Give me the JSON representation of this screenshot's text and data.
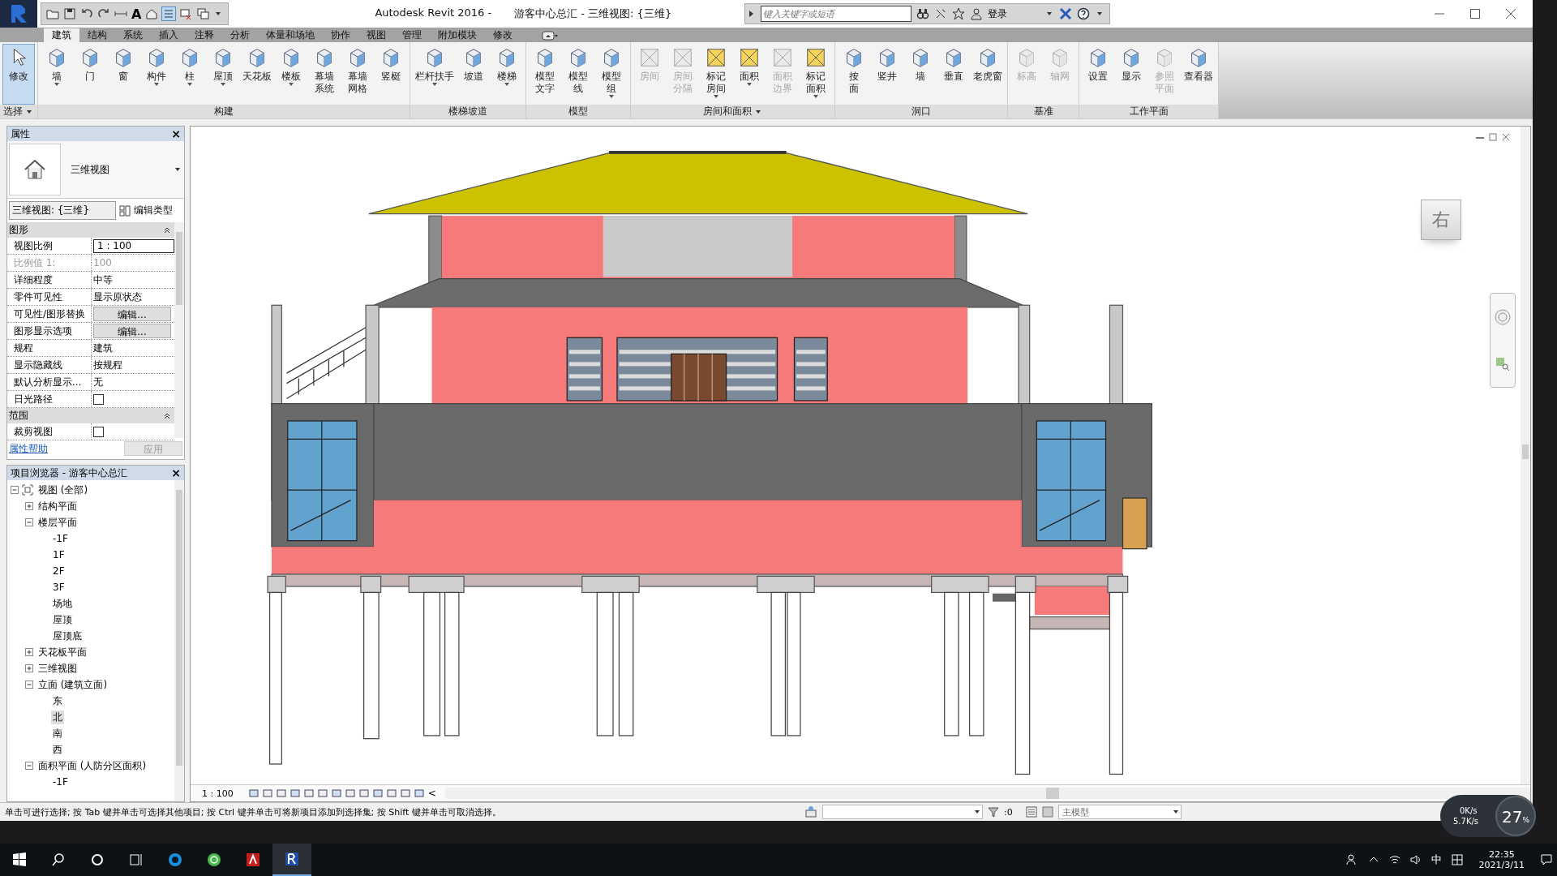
{
  "app": {
    "title": "Autodesk Revit 2016 -",
    "document": "游客中心总汇 - 三维视图: {三维}",
    "qat_text": "A",
    "search": {
      "placeholder": "键入关键字或短语"
    },
    "login": "登录"
  },
  "ribbon": {
    "tabs": [
      {
        "label": "建筑",
        "selected": true
      },
      {
        "label": "结构",
        "selected": false
      },
      {
        "label": "系统",
        "selected": false
      },
      {
        "label": "插入",
        "selected": false
      },
      {
        "label": "注释",
        "selected": false
      },
      {
        "label": "分析",
        "selected": false
      },
      {
        "label": "体量和场地",
        "selected": false
      },
      {
        "label": "协作",
        "selected": false
      },
      {
        "label": "视图",
        "selected": false
      },
      {
        "label": "管理",
        "selected": false
      },
      {
        "label": "附加模块",
        "selected": false
      },
      {
        "label": "修改",
        "selected": false
      }
    ],
    "panels": [
      {
        "label": "选择",
        "menu": true,
        "tools": [
          {
            "label": [
              "修改"
            ],
            "selected": true,
            "disabled": false,
            "dropdown": false
          }
        ]
      },
      {
        "label": "构建",
        "menu": false,
        "tools": [
          {
            "label": [
              "墙"
            ],
            "selected": false,
            "disabled": false,
            "dropdown": true
          },
          {
            "label": [
              "门"
            ],
            "selected": false,
            "disabled": false,
            "dropdown": false
          },
          {
            "label": [
              "窗"
            ],
            "selected": false,
            "disabled": false,
            "dropdown": false
          },
          {
            "label": [
              "构件"
            ],
            "selected": false,
            "disabled": false,
            "dropdown": true
          },
          {
            "label": [
              "柱"
            ],
            "selected": false,
            "disabled": false,
            "dropdown": true
          },
          {
            "label": [
              "屋顶"
            ],
            "selected": false,
            "disabled": false,
            "dropdown": true
          },
          {
            "label": [
              "天花板"
            ],
            "selected": false,
            "disabled": false,
            "dropdown": false
          },
          {
            "label": [
              "楼板"
            ],
            "selected": false,
            "disabled": false,
            "dropdown": true
          },
          {
            "label": [
              "幕墙",
              "系统"
            ],
            "selected": false,
            "disabled": false,
            "dropdown": false
          },
          {
            "label": [
              "幕墙",
              "网格"
            ],
            "selected": false,
            "disabled": false,
            "dropdown": false
          },
          {
            "label": [
              "竖梃"
            ],
            "selected": false,
            "disabled": false,
            "dropdown": false
          }
        ]
      },
      {
        "label": "楼梯坡道",
        "menu": false,
        "tools": [
          {
            "label": [
              "栏杆扶手"
            ],
            "selected": false,
            "disabled": false,
            "dropdown": true
          },
          {
            "label": [
              "坡道"
            ],
            "selected": false,
            "disabled": false,
            "dropdown": false
          },
          {
            "label": [
              "楼梯"
            ],
            "selected": false,
            "disabled": false,
            "dropdown": true
          }
        ]
      },
      {
        "label": "模型",
        "menu": false,
        "tools": [
          {
            "label": [
              "模型",
              "文字"
            ],
            "selected": false,
            "disabled": false,
            "dropdown": false
          },
          {
            "label": [
              "模型",
              "线"
            ],
            "selected": false,
            "disabled": false,
            "dropdown": false
          },
          {
            "label": [
              "模型",
              "组"
            ],
            "selected": false,
            "disabled": false,
            "dropdown": true
          }
        ]
      },
      {
        "label": "房间和面积",
        "menu": true,
        "tools": [
          {
            "label": [
              "房间"
            ],
            "selected": false,
            "disabled": true,
            "dropdown": false
          },
          {
            "label": [
              "房间",
              "分隔"
            ],
            "selected": false,
            "disabled": true,
            "dropdown": false
          },
          {
            "label": [
              "标记",
              "房间"
            ],
            "selected": false,
            "disabled": false,
            "dropdown": true
          },
          {
            "label": [
              "面积"
            ],
            "selected": false,
            "disabled": false,
            "dropdown": true
          },
          {
            "label": [
              "面积",
              "边界"
            ],
            "selected": false,
            "disabled": true,
            "dropdown": false
          },
          {
            "label": [
              "标记",
              "面积"
            ],
            "selected": false,
            "disabled": false,
            "dropdown": true
          }
        ]
      },
      {
        "label": "洞口",
        "menu": false,
        "tools": [
          {
            "label": [
              "按",
              "面"
            ],
            "selected": false,
            "disabled": false,
            "dropdown": false
          },
          {
            "label": [
              "竖井"
            ],
            "selected": false,
            "disabled": false,
            "dropdown": false
          },
          {
            "label": [
              "墙"
            ],
            "selected": false,
            "disabled": false,
            "dropdown": false
          },
          {
            "label": [
              "垂直"
            ],
            "selected": false,
            "disabled": false,
            "dropdown": false
          },
          {
            "label": [
              "老虎窗"
            ],
            "selected": false,
            "disabled": false,
            "dropdown": false
          }
        ]
      },
      {
        "label": "基准",
        "menu": false,
        "tools": [
          {
            "label": [
              "标高"
            ],
            "selected": false,
            "disabled": true,
            "dropdown": false
          },
          {
            "label": [
              "轴网"
            ],
            "selected": false,
            "disabled": true,
            "dropdown": false
          }
        ]
      },
      {
        "label": "工作平面",
        "menu": false,
        "tools": [
          {
            "label": [
              "设置"
            ],
            "selected": false,
            "disabled": false,
            "dropdown": false
          },
          {
            "label": [
              "显示"
            ],
            "selected": false,
            "disabled": false,
            "dropdown": false
          },
          {
            "label": [
              "参照",
              "平面"
            ],
            "selected": false,
            "disabled": true,
            "dropdown": false
          },
          {
            "label": [
              "查看器"
            ],
            "selected": false,
            "disabled": false,
            "dropdown": false
          }
        ]
      }
    ]
  },
  "properties": {
    "title": "属性",
    "close": "×",
    "type_name": "三维视图",
    "instance": "三维视图: {三维}",
    "edit_type": "编辑类型",
    "groups": [
      {
        "label": "图形",
        "expanded": true,
        "rows": [
          {
            "label": "视图比例",
            "kind": "input",
            "value": "1 : 100",
            "disabled": false
          },
          {
            "label": "比例值 1:",
            "kind": "text",
            "value": "100",
            "disabled": true
          },
          {
            "label": "详细程度",
            "kind": "text",
            "value": "中等",
            "disabled": false
          },
          {
            "label": "零件可见性",
            "kind": "text",
            "value": "显示原状态",
            "disabled": false
          },
          {
            "label": "可见性/图形替换",
            "kind": "button",
            "value": "编辑...",
            "disabled": false
          },
          {
            "label": "图形显示选项",
            "kind": "button",
            "value": "编辑...",
            "disabled": false
          },
          {
            "label": "规程",
            "kind": "text",
            "value": "建筑",
            "disabled": false
          },
          {
            "label": "显示隐藏线",
            "kind": "text",
            "value": "按规程",
            "disabled": false
          },
          {
            "label": "默认分析显示...",
            "kind": "text",
            "value": "无",
            "disabled": false
          },
          {
            "label": "日光路径",
            "kind": "checkbox",
            "checked": false,
            "disabled": false
          }
        ]
      },
      {
        "label": "范围",
        "expanded": true,
        "rows": [
          {
            "label": "裁剪视图",
            "kind": "checkbox",
            "checked": false,
            "disabled": false
          }
        ]
      }
    ],
    "help": "属性帮助",
    "apply": {
      "label": "应用",
      "disabled": true
    }
  },
  "browser": {
    "title": "项目浏览器 - 游客中心总汇",
    "close": "×",
    "tree": [
      {
        "label": "视图 (全部)",
        "expanded": true,
        "selected": false,
        "children": [
          {
            "label": "结构平面",
            "expanded": false,
            "selected": false
          },
          {
            "label": "楼层平面",
            "expanded": true,
            "selected": false,
            "children": [
              {
                "label": "-1F",
                "selected": false
              },
              {
                "label": "1F",
                "selected": false
              },
              {
                "label": "2F",
                "selected": false
              },
              {
                "label": "3F",
                "selected": false
              },
              {
                "label": "场地",
                "selected": false
              },
              {
                "label": "屋顶",
                "selected": false
              },
              {
                "label": "屋顶底",
                "selected": false
              }
            ]
          },
          {
            "label": "天花板平面",
            "expanded": false,
            "selected": false
          },
          {
            "label": "三维视图",
            "expanded": false,
            "selected": false
          },
          {
            "label": "立面 (建筑立面)",
            "expanded": true,
            "selected": false,
            "children": [
              {
                "label": "东",
                "selected": false
              },
              {
                "label": "北",
                "selected": true
              },
              {
                "label": "南",
                "selected": false
              },
              {
                "label": "西",
                "selected": false
              }
            ]
          },
          {
            "label": "面积平面 (人防分区面积)",
            "expanded": true,
            "selected": false,
            "children": [
              {
                "label": "-1F",
                "selected": false
              }
            ]
          }
        ]
      }
    ]
  },
  "view": {
    "cube_label": "右",
    "scale": "1 : 100",
    "collapse": "<"
  },
  "status": {
    "message": "单击可进行选择; 按 Tab 键并单击可选择其他项目; 按 Ctrl 键并单击可将新项目添加到选择集; 按 Shift 键并单击可取消选择。",
    "filter_count": ":0",
    "model": "主模型"
  },
  "net_widget": {
    "upload": "0K/s",
    "download": "5.7K/s",
    "cpu": "27",
    "unit": "%"
  },
  "taskbar": {
    "ime": "中",
    "time": "22:35",
    "date": "2021/3/11"
  }
}
